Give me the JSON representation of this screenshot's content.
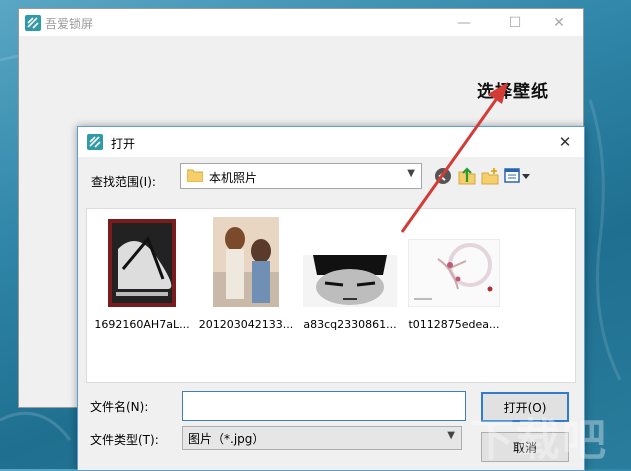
{
  "main_window": {
    "title": "吾爱锁屏",
    "annotation": "选择壁纸",
    "controls": {
      "minimize": "—",
      "maximize": "☐",
      "close": "✕"
    }
  },
  "dialog": {
    "title": "打开",
    "close_glyph": "✕",
    "lookin_label": "查找范围(I):",
    "lookin_value": "本机照片",
    "files": [
      {
        "name": "1692160AH7aL..."
      },
      {
        "name": "201203042133..."
      },
      {
        "name": "a83cq2330861..."
      },
      {
        "name": "t0112875edea..."
      }
    ],
    "filename_label": "文件名(N):",
    "filename_value": "",
    "filetype_label": "文件类型(T):",
    "filetype_value": "图片（*.jpg）",
    "open_button": "打开(O)",
    "cancel_button": "取消"
  },
  "watermark": "下载吧",
  "colors": {
    "accent": "#2f7bd1",
    "arrow": "#d33b36",
    "app_icon": "#2f9aa8"
  },
  "icons": [
    "app-logo-icon",
    "folder-icon",
    "back-icon",
    "up-folder-icon",
    "new-folder-icon",
    "view-menu-icon",
    "chevron-down-icon"
  ]
}
